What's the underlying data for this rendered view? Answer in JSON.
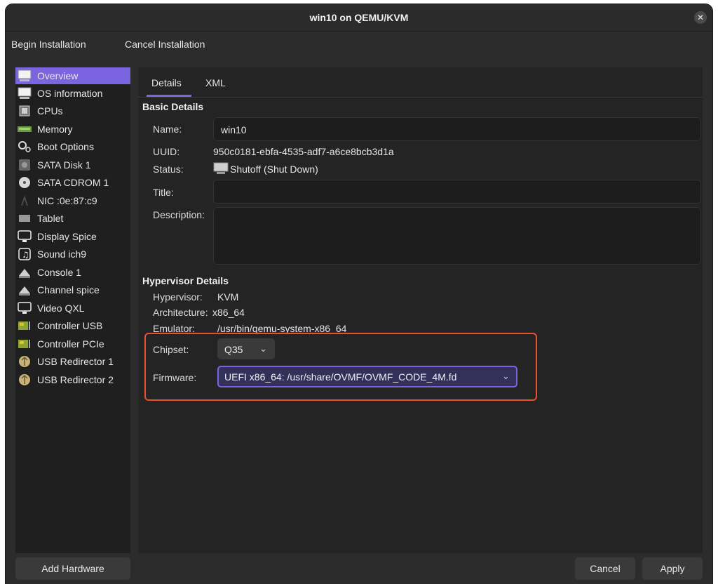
{
  "window": {
    "title": "win10 on QEMU/KVM"
  },
  "menubar": {
    "begin_installation": "Begin Installation",
    "cancel_installation": "Cancel Installation"
  },
  "sidebar": {
    "items": [
      {
        "label": "Overview",
        "icon": "monitor-icon",
        "selected": true
      },
      {
        "label": "OS information",
        "icon": "monitor-icon"
      },
      {
        "label": "CPUs",
        "icon": "cpu-icon"
      },
      {
        "label": "Memory",
        "icon": "memory-icon"
      },
      {
        "label": "Boot Options",
        "icon": "gears-icon"
      },
      {
        "label": "SATA Disk 1",
        "icon": "disk-icon"
      },
      {
        "label": "SATA CDROM 1",
        "icon": "cdrom-icon"
      },
      {
        "label": "NIC :0e:87:c9",
        "icon": "network-icon"
      },
      {
        "label": "Tablet",
        "icon": "tablet-icon"
      },
      {
        "label": "Display Spice",
        "icon": "display-icon"
      },
      {
        "label": "Sound ich9",
        "icon": "sound-icon"
      },
      {
        "label": "Console 1",
        "icon": "console-icon"
      },
      {
        "label": "Channel spice",
        "icon": "channel-icon"
      },
      {
        "label": "Video QXL",
        "icon": "video-icon"
      },
      {
        "label": "Controller USB",
        "icon": "controller-icon"
      },
      {
        "label": "Controller PCIe",
        "icon": "controller-icon"
      },
      {
        "label": "USB Redirector 1",
        "icon": "usb-redirector-icon"
      },
      {
        "label": "USB Redirector 2",
        "icon": "usb-redirector-icon"
      }
    ],
    "add_hardware": "Add Hardware"
  },
  "tabs": {
    "details": "Details",
    "xml": "XML",
    "active": "Details"
  },
  "basic": {
    "section": "Basic Details",
    "name_label": "Name:",
    "name_value": "win10",
    "uuid_label": "UUID:",
    "uuid_value": "950c0181-ebfa-4535-adf7-a6ce8bcb3d1a",
    "status_label": "Status:",
    "status_value": "Shutoff (Shut Down)",
    "title_label": "Title:",
    "title_value": "",
    "description_label": "Description:",
    "description_value": ""
  },
  "hypervisor": {
    "section": "Hypervisor Details",
    "hypervisor_label": "Hypervisor:",
    "hypervisor_value": "KVM",
    "architecture_label": "Architecture:",
    "architecture_value": "x86_64",
    "emulator_label": "Emulator:",
    "emulator_value": "/usr/bin/qemu-system-x86_64",
    "chipset_label": "Chipset:",
    "chipset_value": "Q35",
    "firmware_label": "Firmware:",
    "firmware_value": "UEFI x86_64: /usr/share/OVMF/OVMF_CODE_4M.fd"
  },
  "buttons": {
    "cancel": "Cancel",
    "apply": "Apply"
  },
  "colors": {
    "accent": "#7a64e0",
    "highlight": "#e8502e",
    "background": "#2c2c2c"
  }
}
